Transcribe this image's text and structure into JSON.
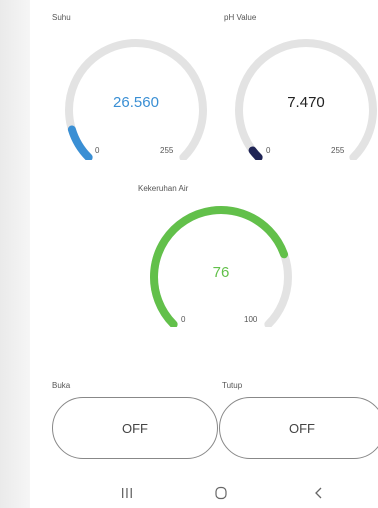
{
  "gauges": {
    "suhu": {
      "label": "Suhu",
      "value": "26.560",
      "min": "0",
      "max": "255",
      "fraction": 0.104,
      "color": "#3a8fd4"
    },
    "ph": {
      "label": "pH Value",
      "value": "7.470",
      "min": "0",
      "max": "255",
      "fraction": 0.029,
      "color": "#1f2455"
    },
    "kekeruhan": {
      "label": "Kekeruhan Air",
      "value": "76",
      "min": "0",
      "max": "100",
      "fraction": 0.76,
      "color": "#62c04a"
    }
  },
  "switches": {
    "buka": {
      "label": "Buka",
      "state": "OFF"
    },
    "tutup": {
      "label": "Tutup",
      "state": "OFF"
    }
  },
  "nav": {
    "recents_icon": "recent-apps-icon",
    "home_icon": "home-icon",
    "back_icon": "back-icon"
  },
  "colors": {
    "track": "#e3e3e3",
    "background": "#ffffff"
  }
}
